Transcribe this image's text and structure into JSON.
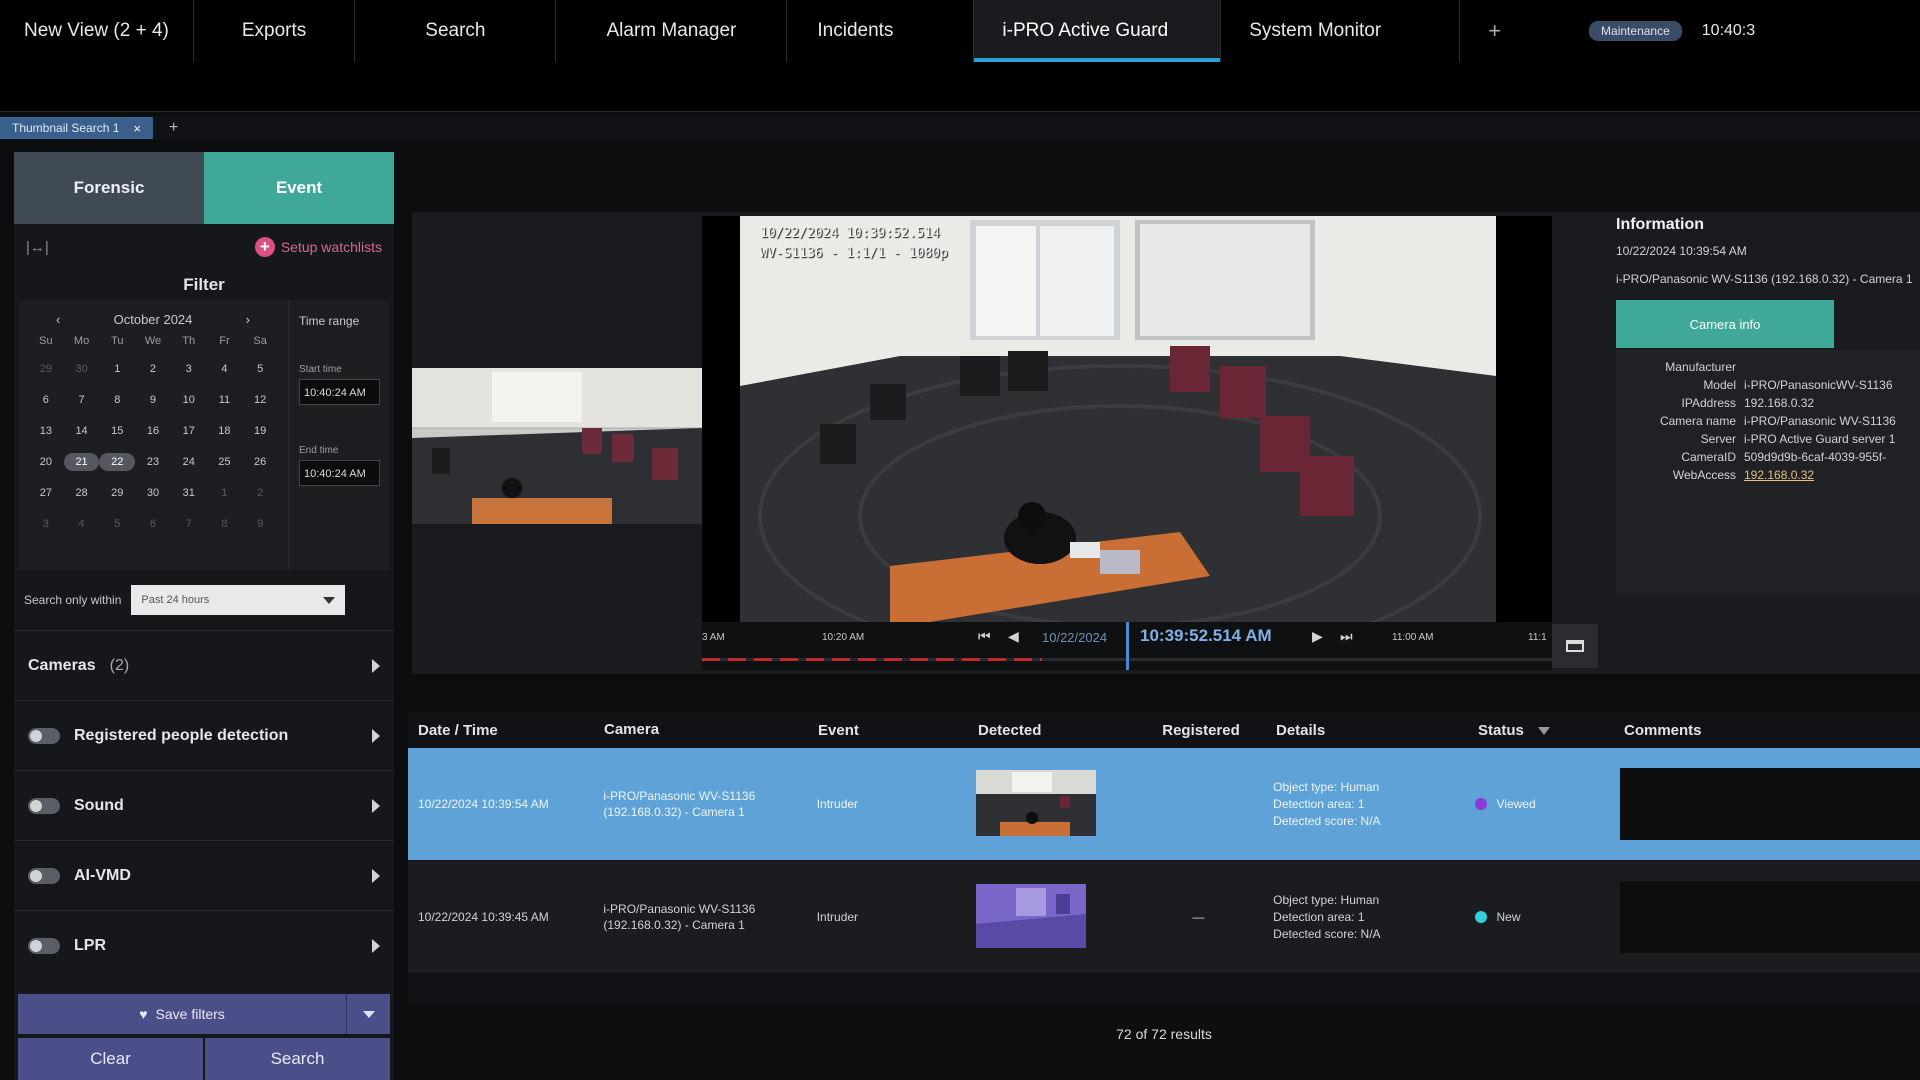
{
  "topbar": {
    "tabs": [
      "New View (2 + 4)",
      "Exports",
      "Search",
      "Alarm Manager",
      "Incidents",
      "i-PRO Active Guard",
      "System Monitor"
    ],
    "active_tab": "i-PRO Active Guard",
    "plus": "+",
    "license": "Maintenance",
    "clock": "10:40:3"
  },
  "subtab": {
    "label": "Thumbnail Search 1",
    "close": "×",
    "plus": "+"
  },
  "left": {
    "mode_forensic": "Forensic",
    "mode_event": "Event",
    "collapse": "|↔|",
    "setup_watchlists": "Setup watchlists",
    "filter_title": "Filter",
    "calendar": {
      "prev": "‹",
      "month": "October 2024",
      "next": "›",
      "dow": [
        "Su",
        "Mo",
        "Tu",
        "We",
        "Th",
        "Fr",
        "Sa"
      ],
      "days": [
        {
          "d": "29",
          "m": true
        },
        {
          "d": "30",
          "m": true
        },
        {
          "d": "1"
        },
        {
          "d": "2"
        },
        {
          "d": "3"
        },
        {
          "d": "4"
        },
        {
          "d": "5"
        },
        {
          "d": "6"
        },
        {
          "d": "7"
        },
        {
          "d": "8"
        },
        {
          "d": "9"
        },
        {
          "d": "10"
        },
        {
          "d": "11"
        },
        {
          "d": "12"
        },
        {
          "d": "13"
        },
        {
          "d": "14"
        },
        {
          "d": "15"
        },
        {
          "d": "16"
        },
        {
          "d": "17"
        },
        {
          "d": "18"
        },
        {
          "d": "19"
        },
        {
          "d": "20"
        },
        {
          "d": "21",
          "s": true
        },
        {
          "d": "22",
          "s": true
        },
        {
          "d": "23"
        },
        {
          "d": "24"
        },
        {
          "d": "25"
        },
        {
          "d": "26"
        },
        {
          "d": "27"
        },
        {
          "d": "28"
        },
        {
          "d": "29"
        },
        {
          "d": "30"
        },
        {
          "d": "31"
        },
        {
          "d": "1",
          "m": true
        },
        {
          "d": "2",
          "m": true
        },
        {
          "d": "3",
          "m": true
        },
        {
          "d": "4",
          "m": true
        },
        {
          "d": "5",
          "m": true
        },
        {
          "d": "6",
          "m": true
        },
        {
          "d": "7",
          "m": true
        },
        {
          "d": "8",
          "m": true
        },
        {
          "d": "9",
          "m": true
        }
      ]
    },
    "time_range_label": "Time range",
    "start_label": "Start time",
    "start_value": "10:40:24 AM",
    "end_label": "End time",
    "end_value": "10:40:24 AM",
    "search_within_label": "Search only within",
    "search_within_value": "Past 24 hours",
    "sections": [
      {
        "label": "Cameras",
        "count": "(2)",
        "toggle": false
      },
      {
        "label": "Registered people detection",
        "count": "",
        "toggle": true
      },
      {
        "label": "Sound",
        "count": "",
        "toggle": true
      },
      {
        "label": "AI-VMD",
        "count": "",
        "toggle": true
      },
      {
        "label": "LPR",
        "count": "",
        "toggle": true
      }
    ],
    "save_filters": "Save filters",
    "clear": "Clear",
    "search": "Search"
  },
  "video": {
    "osd_date": "10/22/2024 10:39:52.514",
    "osd_camera": "WV-S1136 - 1:1/1 - 1080p",
    "timeline": {
      "tick_left": "3 AM",
      "tick_1020": "10:20 AM",
      "date": "10/22/2024",
      "time": "10:39:52.514 AM",
      "tick_1100": "11:00 AM",
      "tick_right": "11:1"
    }
  },
  "info": {
    "title": "Information",
    "datetime": "10/22/2024 10:39:54 AM",
    "source": "i-PRO/Panasonic WV-S1136 (192.168.0.32) - Camera 1",
    "camera_info_button": "Camera info",
    "rows": [
      {
        "k": "Manufacturer",
        "v": ""
      },
      {
        "k": "Model",
        "v": "i-PRO/PanasonicWV-S1136"
      },
      {
        "k": "IPAddress",
        "v": "192.168.0.32"
      },
      {
        "k": "Camera name",
        "v": "i-PRO/Panasonic WV-S1136"
      },
      {
        "k": "Server",
        "v": "i-PRO Active Guard server 1"
      },
      {
        "k": "CameraID",
        "v": "509d9d9b-6caf-4039-955f-"
      },
      {
        "k": "WebAccess",
        "v": "192.168.0.32",
        "link": true
      }
    ]
  },
  "results": {
    "headers": [
      "Date / Time",
      "Camera",
      "Event",
      "Detected",
      "Registered",
      "Details",
      "Status",
      "Comments"
    ],
    "rows": [
      {
        "datetime": "10/22/2024 10:39:54 AM",
        "camera_1": "i-PRO/Panasonic WV-S1136",
        "camera_2": "(192.168.0.32) - Camera 1",
        "event": "Intruder",
        "registered": "",
        "detail_1": "Object type: Human",
        "detail_2": "Detection area: 1",
        "detail_3": "Detected score: N/A",
        "status": "Viewed",
        "status_color": "#8a3ad6"
      },
      {
        "datetime": "10/22/2024 10:39:45 AM",
        "camera_1": "i-PRO/Panasonic WV-S1136",
        "camera_2": "(192.168.0.32) - Camera 1",
        "event": "Intruder",
        "registered": "—",
        "detail_1": "Object type: Human",
        "detail_2": "Detection area: 1",
        "detail_3": "Detected score: N/A",
        "status": "New",
        "status_color": "#2fd0d8"
      }
    ],
    "count": "72 of 72 results"
  },
  "colors": {
    "accent_teal": "#3fa898",
    "accent_blue": "#2aa0d8",
    "selected_row": "#5fa2d8",
    "button_indigo": "#4a4f8a"
  }
}
